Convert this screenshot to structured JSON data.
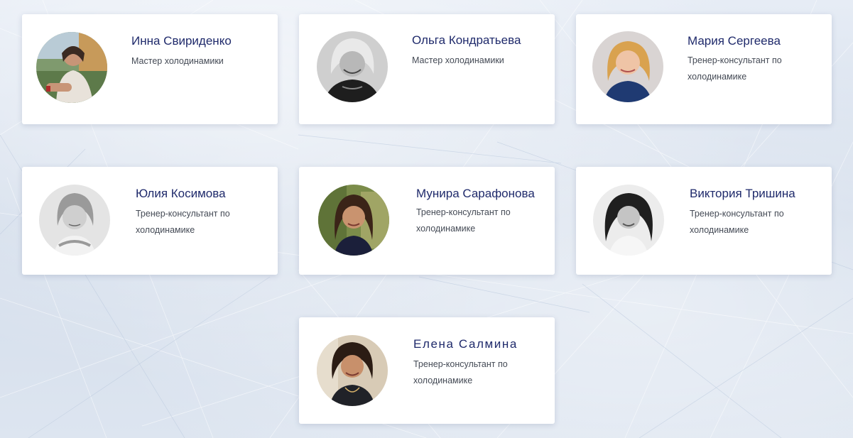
{
  "team": {
    "members": [
      {
        "name": "Инна Свириденко",
        "role": "Мастер холодинамики"
      },
      {
        "name": "Ольга Кондратьева",
        "role": "Мастер холодинамики"
      },
      {
        "name": "Мария Сергеева",
        "role": "Тренер-консультант по холодинамике"
      },
      {
        "name": "Юлия Косимова",
        "role": "Тренер-консультант по холодинамике"
      },
      {
        "name": "Мунира Сарафонова",
        "role": "Тренер-консультант по холодинамике"
      },
      {
        "name": "Виктория Тришина",
        "role": "Тренер-консультант по холодинамике"
      },
      {
        "name": "Елена Салмина",
        "role": "Тренер-консультант по холодинамике"
      }
    ]
  },
  "colors": {
    "name_text": "#1f2a6b",
    "role_text": "#444a55",
    "card_bg": "#ffffff",
    "page_bg": "#d7e1ee"
  }
}
